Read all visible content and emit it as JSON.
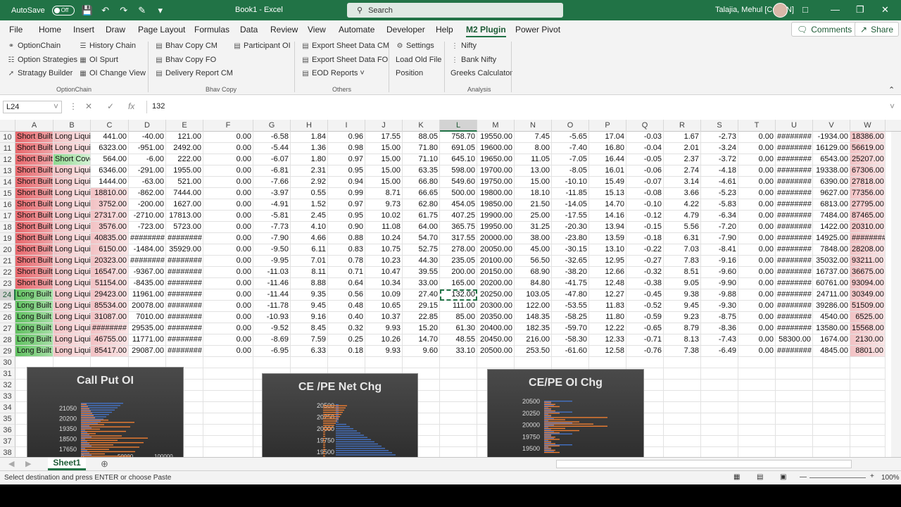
{
  "titlebar": {
    "autosave_label": "AutoSave",
    "autosave_state": "Off",
    "doc_title": "Book1  -  Excel",
    "search_placeholder": "Search",
    "user_name": "Talajia, Mehul [CONIN]"
  },
  "menu": {
    "tabs": [
      "File",
      "Home",
      "Insert",
      "Draw",
      "Page Layout",
      "Formulas",
      "Data",
      "Review",
      "View",
      "Automate",
      "Developer",
      "Help",
      "M2 Plugin",
      "Power Pivot"
    ],
    "active_tab": "M2 Plugin",
    "comments_label": "Comments",
    "share_label": "Share"
  },
  "ribbon": {
    "optionchain": {
      "label": "OptionChain",
      "items": [
        "OptionChain",
        "Option Strategies",
        "Stratagy Builder",
        "History Chain",
        "OI Spurt",
        "OI Change View"
      ]
    },
    "bhavcopy": {
      "label": "Bhav Copy",
      "items": [
        "Bhav Copy CM",
        "Bhav Copy FO",
        "Delivery Report CM",
        "Participant OI"
      ]
    },
    "others": {
      "label": "Others",
      "items": [
        "Export Sheet Data CM",
        "Export Sheet Data FO",
        "EOD Reports"
      ]
    },
    "misc": {
      "items": [
        "Settings",
        "Load Old File",
        "Position"
      ]
    },
    "analysis": {
      "label": "Analysis",
      "items": [
        "Nifty",
        "Bank Nifty",
        "Greeks Calculator"
      ]
    }
  },
  "formula_bar": {
    "name_box": "L24",
    "formula": "132"
  },
  "columns": [
    "A",
    "B",
    "C",
    "D",
    "E",
    "F",
    "G",
    "H",
    "I",
    "J",
    "K",
    "L",
    "M",
    "N",
    "O",
    "P",
    "Q",
    "R",
    "S",
    "T",
    "U",
    "V",
    "W"
  ],
  "selected_column": "L",
  "selected_row": "24",
  "rows": [
    {
      "n": "10",
      "c": [
        "Short Built",
        "Long Liqui",
        "441.00",
        "-40.00",
        "121.00",
        "0.00",
        "-6.58",
        "1.84",
        "0.96",
        "17.55",
        "88.05",
        "758.70",
        "19550.00",
        "7.45",
        "-5.65",
        "17.04",
        "-0.03",
        "1.67",
        "-2.73",
        "0.00",
        "########",
        "-1934.00",
        "18386.00"
      ]
    },
    {
      "n": "11",
      "c": [
        "Short Built",
        "Long Liqui",
        "6323.00",
        "-951.00",
        "2492.00",
        "0.00",
        "-5.44",
        "1.36",
        "0.98",
        "15.00",
        "71.80",
        "691.05",
        "19600.00",
        "8.00",
        "-7.40",
        "16.80",
        "-0.04",
        "2.01",
        "-3.24",
        "0.00",
        "########",
        "16129.00",
        "56619.00"
      ]
    },
    {
      "n": "12",
      "c": [
        "Short Built",
        "Short Cove",
        "564.00",
        "-6.00",
        "222.00",
        "0.00",
        "-6.07",
        "1.80",
        "0.97",
        "15.00",
        "71.10",
        "645.10",
        "19650.00",
        "11.05",
        "-7.05",
        "16.44",
        "-0.05",
        "2.37",
        "-3.72",
        "0.00",
        "########",
        "6543.00",
        "25207.00"
      ]
    },
    {
      "n": "13",
      "c": [
        "Short Built",
        "Long Liqui",
        "6346.00",
        "-291.00",
        "1955.00",
        "0.00",
        "-6.81",
        "2.31",
        "0.95",
        "15.00",
        "63.35",
        "598.00",
        "19700.00",
        "13.00",
        "-8.05",
        "16.01",
        "-0.06",
        "2.74",
        "-4.18",
        "0.00",
        "########",
        "19338.00",
        "67306.00"
      ]
    },
    {
      "n": "14",
      "c": [
        "Short Built",
        "Long Liqui",
        "1444.00",
        "-63.00",
        "521.00",
        "0.00",
        "-7.66",
        "2.92",
        "0.94",
        "15.00",
        "66.80",
        "549.60",
        "19750.00",
        "15.00",
        "-10.10",
        "15.49",
        "-0.07",
        "3.14",
        "-4.61",
        "0.00",
        "########",
        "6390.00",
        "27818.00"
      ]
    },
    {
      "n": "15",
      "c": [
        "Short Built",
        "Long Liqui",
        "18810.00",
        "-862.00",
        "7444.00",
        "0.00",
        "-3.97",
        "0.55",
        "0.99",
        "8.71",
        "66.65",
        "500.00",
        "19800.00",
        "18.10",
        "-11.85",
        "15.13",
        "-0.08",
        "3.66",
        "-5.23",
        "0.00",
        "########",
        "9627.00",
        "77356.00"
      ]
    },
    {
      "n": "16",
      "c": [
        "Short Built",
        "Long Liqui",
        "3752.00",
        "-200.00",
        "1627.00",
        "0.00",
        "-4.91",
        "1.52",
        "0.97",
        "9.73",
        "62.80",
        "454.05",
        "19850.00",
        "21.50",
        "-14.05",
        "14.70",
        "-0.10",
        "4.22",
        "-5.83",
        "0.00",
        "########",
        "6813.00",
        "27795.00"
      ]
    },
    {
      "n": "17",
      "c": [
        "Short Built",
        "Long Liqui",
        "27317.00",
        "-2710.00",
        "17813.00",
        "0.00",
        "-5.81",
        "2.45",
        "0.95",
        "10.02",
        "61.75",
        "407.25",
        "19900.00",
        "25.00",
        "-17.55",
        "14.16",
        "-0.12",
        "4.79",
        "-6.34",
        "0.00",
        "########",
        "7484.00",
        "87465.00"
      ]
    },
    {
      "n": "18",
      "c": [
        "Short Built",
        "Long Liqui",
        "3576.00",
        "-723.00",
        "5723.00",
        "0.00",
        "-7.73",
        "4.10",
        "0.90",
        "11.08",
        "64.00",
        "365.75",
        "19950.00",
        "31.25",
        "-20.30",
        "13.94",
        "-0.15",
        "5.56",
        "-7.20",
        "0.00",
        "########",
        "1422.00",
        "20310.00"
      ]
    },
    {
      "n": "19",
      "c": [
        "Short Built",
        "Long Liqui",
        "40835.00",
        "########",
        "########",
        "0.00",
        "-7.90",
        "4.66",
        "0.88",
        "10.24",
        "54.70",
        "317.55",
        "20000.00",
        "38.00",
        "-23.80",
        "13.59",
        "-0.18",
        "6.31",
        "-7.90",
        "0.00",
        "########",
        "14925.00",
        "########"
      ]
    },
    {
      "n": "20",
      "c": [
        "Short Built",
        "Long Liqui",
        "6150.00",
        "-1484.00",
        "35929.00",
        "0.00",
        "-9.50",
        "6.11",
        "0.83",
        "10.75",
        "52.75",
        "278.00",
        "20050.00",
        "45.00",
        "-30.15",
        "13.10",
        "-0.22",
        "7.03",
        "-8.41",
        "0.00",
        "########",
        "7848.00",
        "28208.00"
      ]
    },
    {
      "n": "21",
      "c": [
        "Short Built",
        "Long Liqui",
        "20323.00",
        "########",
        "########",
        "0.00",
        "-9.95",
        "7.01",
        "0.78",
        "10.23",
        "44.30",
        "235.05",
        "20100.00",
        "56.50",
        "-32.65",
        "12.95",
        "-0.27",
        "7.83",
        "-9.16",
        "0.00",
        "########",
        "35032.00",
        "93211.00"
      ]
    },
    {
      "n": "22",
      "c": [
        "Short Built",
        "Long Liqui",
        "16547.00",
        "-9367.00",
        "########",
        "0.00",
        "-11.03",
        "8.11",
        "0.71",
        "10.47",
        "39.55",
        "200.00",
        "20150.00",
        "68.90",
        "-38.20",
        "12.66",
        "-0.32",
        "8.51",
        "-9.60",
        "0.00",
        "########",
        "16737.00",
        "36675.00"
      ]
    },
    {
      "n": "23",
      "c": [
        "Short Built",
        "Long Liqui",
        "51154.00",
        "-8435.00",
        "########",
        "0.00",
        "-11.46",
        "8.88",
        "0.64",
        "10.34",
        "33.00",
        "165.00",
        "20200.00",
        "84.80",
        "-41.75",
        "12.48",
        "-0.38",
        "9.05",
        "-9.90",
        "0.00",
        "########",
        "60761.00",
        "93094.00"
      ]
    },
    {
      "n": "24",
      "c": [
        "Long Built",
        "Long Liqui",
        "29423.00",
        "11961.00",
        "########",
        "0.00",
        "-11.44",
        "9.35",
        "0.56",
        "10.09",
        "27.40",
        "132.00",
        "20250.00",
        "103.05",
        "-47.80",
        "12.27",
        "-0.45",
        "9.38",
        "-9.88",
        "0.00",
        "########",
        "24711.00",
        "30349.00"
      ]
    },
    {
      "n": "25",
      "c": [
        "Long Built",
        "Long Liqui",
        "85534.00",
        "20078.00",
        "########",
        "0.00",
        "-11.78",
        "9.45",
        "0.48",
        "10.65",
        "29.15",
        "111.00",
        "20300.00",
        "122.00",
        "-53.55",
        "11.83",
        "-0.52",
        "9.45",
        "-9.30",
        "0.00",
        "########",
        "39286.00",
        "51509.00"
      ]
    },
    {
      "n": "26",
      "c": [
        "Long Built",
        "Long Liqui",
        "31087.00",
        "7010.00",
        "########",
        "0.00",
        "-10.93",
        "9.16",
        "0.40",
        "10.37",
        "22.85",
        "85.00",
        "20350.00",
        "148.35",
        "-58.25",
        "11.80",
        "-0.59",
        "9.23",
        "-8.75",
        "0.00",
        "########",
        "4540.00",
        "6525.00"
      ]
    },
    {
      "n": "27",
      "c": [
        "Long Built",
        "Long Liqui",
        "########",
        "29535.00",
        "########",
        "0.00",
        "-9.52",
        "8.45",
        "0.32",
        "9.93",
        "15.20",
        "61.30",
        "20400.00",
        "182.35",
        "-59.70",
        "12.22",
        "-0.65",
        "8.79",
        "-8.36",
        "0.00",
        "########",
        "13580.00",
        "15568.00"
      ]
    },
    {
      "n": "28",
      "c": [
        "Long Built",
        "Long Liqui",
        "46755.00",
        "11771.00",
        "########",
        "0.00",
        "-8.69",
        "7.59",
        "0.25",
        "10.26",
        "14.70",
        "48.55",
        "20450.00",
        "216.00",
        "-58.30",
        "12.33",
        "-0.71",
        "8.13",
        "-7.43",
        "0.00",
        "58300.00",
        "1674.00",
        "2130.00"
      ]
    },
    {
      "n": "29",
      "c": [
        "Long Built",
        "Long Liqui",
        "85417.00",
        "29087.00",
        "########",
        "0.00",
        "-6.95",
        "6.33",
        "0.18",
        "9.93",
        "9.60",
        "33.10",
        "20500.00",
        "253.50",
        "-61.60",
        "12.58",
        "-0.76",
        "7.38",
        "-6.49",
        "0.00",
        "########",
        "4845.00",
        "8801.00"
      ]
    }
  ],
  "empty_rows": [
    "30",
    "31",
    "32",
    "33",
    "34",
    "35",
    "36",
    "37",
    "38"
  ],
  "charts": [
    {
      "title": "Call Put OI",
      "y_ticks": [
        "21050",
        "20200",
        "19350",
        "18500",
        "17650"
      ],
      "x_ticks": [
        "0",
        "50000",
        "100000",
        "150000"
      ]
    },
    {
      "title": "CE /PE Net Chg",
      "y_ticks": [
        "20500",
        "20250",
        "20000",
        "19750",
        "19500"
      ]
    },
    {
      "title": "CE/PE OI Chg",
      "y_ticks": [
        "20500",
        "20250",
        "20000",
        "19750",
        "19500"
      ]
    }
  ],
  "chart_colors": {
    "ce": "#4472c4",
    "pe": "#ed7d31"
  },
  "sheet": {
    "tab": "Sheet1"
  },
  "status": {
    "text": "Select destination and press ENTER or choose Paste",
    "zoom": "100%"
  }
}
